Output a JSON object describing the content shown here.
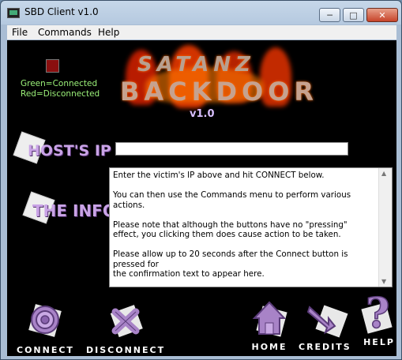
{
  "window": {
    "title": "SBD Client v1.0"
  },
  "menu": [
    "File",
    "Commands",
    "Help"
  ],
  "status": {
    "color": "#8a0f0f",
    "legend_green": "Green=Connected",
    "legend_red": "Red=Disconnected"
  },
  "logo": {
    "line1": "SATANZ",
    "line2": "BACKDOOR",
    "version": "v1.0"
  },
  "host": {
    "label": "HOST'S IP",
    "value": ""
  },
  "info": {
    "label": "THE INFO",
    "text": "Enter the victim's IP above and hit CONNECT below.\n\nYou can then use the Commands menu to perform various\nactions.\n\nPlease note that although the buttons have no \"pressing\"\neffect, you clicking them does cause action to be taken.\n\nPlease allow up to 20 seconds after the Connect button is pressed for\nthe confirmation text to appear here."
  },
  "buttons": {
    "connect": "CONNECT",
    "disconnect": "DISCONNECT",
    "home": "HOME",
    "credits": "CREDITS",
    "help": "HELP"
  },
  "icons": {
    "status": "status-led-icon",
    "connect": "target-icon",
    "disconnect": "x-icon",
    "home": "house-icon",
    "credits": "arrow-icon",
    "help": "question-mark-icon"
  }
}
